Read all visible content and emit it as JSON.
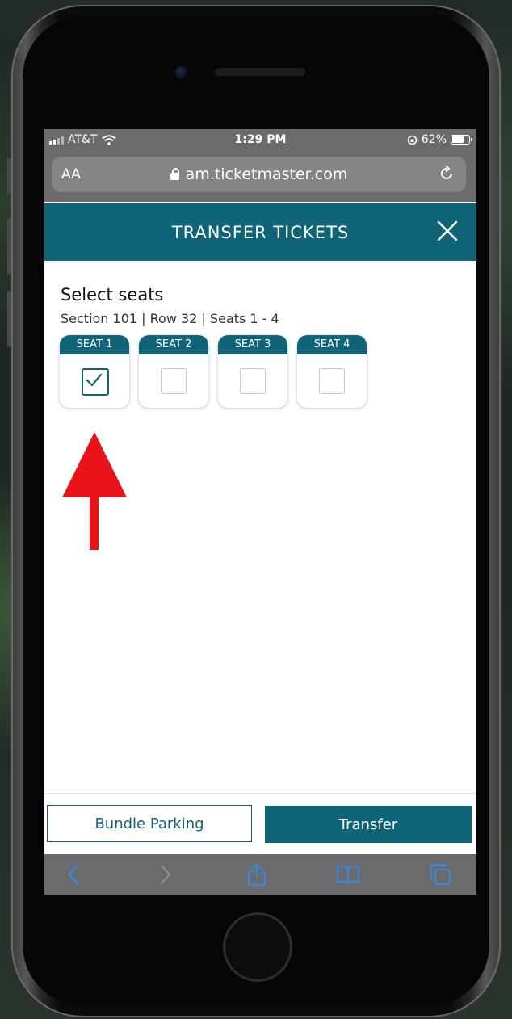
{
  "status": {
    "carrier": "AT&T",
    "time": "1:29 PM",
    "battery": "62%"
  },
  "browser": {
    "text_size": "AA",
    "url": "am.ticketmaster.com"
  },
  "header": {
    "title": "TRANSFER TICKETS"
  },
  "selection": {
    "title": "Select seats",
    "subtitle": "Section 101 | Row 32 | Seats 1 - 4",
    "seats": [
      {
        "label": "SEAT 1",
        "checked": true
      },
      {
        "label": "SEAT 2",
        "checked": false
      },
      {
        "label": "SEAT 3",
        "checked": false
      },
      {
        "label": "SEAT 4",
        "checked": false
      }
    ]
  },
  "actions": {
    "bundle_label": "Bundle Parking",
    "transfer_label": "Transfer"
  },
  "colors": {
    "brand": "#0f6478",
    "annotation_arrow": "#e8141a"
  },
  "icons": {
    "close": "close-icon",
    "lock": "lock-icon",
    "reload": "reload-icon",
    "back": "chevron-left-icon",
    "forward": "chevron-right-icon",
    "share": "share-icon",
    "bookmarks": "book-icon",
    "tabs": "tabs-icon"
  }
}
